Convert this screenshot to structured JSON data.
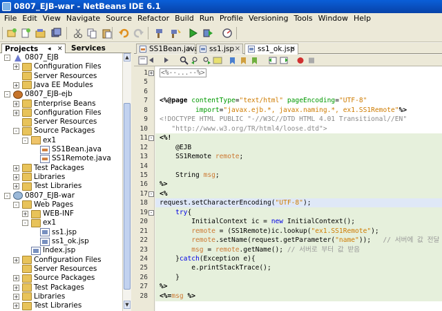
{
  "window": {
    "title": "0807_EJB-war - NetBeans IDE 6.1"
  },
  "menu": [
    "File",
    "Edit",
    "View",
    "Navigate",
    "Source",
    "Refactor",
    "Build",
    "Run",
    "Profile",
    "Versioning",
    "Tools",
    "Window",
    "Help"
  ],
  "toolbar": {
    "icons": [
      "new-project-icon",
      "new-file-icon",
      "open-project-icon",
      "save-all-icon",
      "cut-icon",
      "copy-icon",
      "paste-icon",
      "undo-icon",
      "redo-icon",
      "clean-build-icon",
      "build-icon",
      "run-icon",
      "debug-icon",
      "profile-icon"
    ]
  },
  "panel": {
    "tab_projects": "Projects",
    "tab_services": "Services",
    "tree": [
      {
        "label": "0807_EJB",
        "icon": "project-icon",
        "indent": 0,
        "toggle": "-"
      },
      {
        "label": "Configuration Files",
        "icon": "folder-icon",
        "indent": 1,
        "toggle": "+"
      },
      {
        "label": "Server Resources",
        "icon": "folder-icon",
        "indent": 1,
        "toggle": ""
      },
      {
        "label": "Java EE Modules",
        "icon": "folder-icon",
        "indent": 1,
        "toggle": "+"
      },
      {
        "label": "0807_EJB-ejb",
        "icon": "bean-icon",
        "indent": 0,
        "toggle": "-"
      },
      {
        "label": "Enterprise Beans",
        "icon": "folder-icon",
        "indent": 1,
        "toggle": "+"
      },
      {
        "label": "Configuration Files",
        "icon": "folder-icon",
        "indent": 1,
        "toggle": "+"
      },
      {
        "label": "Server Resources",
        "icon": "folder-icon",
        "indent": 1,
        "toggle": ""
      },
      {
        "label": "Source Packages",
        "icon": "folder-icon",
        "indent": 1,
        "toggle": "-"
      },
      {
        "label": "ex1",
        "icon": "package-icon",
        "indent": 2,
        "toggle": "-"
      },
      {
        "label": "SS1Bean.java",
        "icon": "java-file-icon",
        "indent": 3,
        "toggle": ""
      },
      {
        "label": "SS1Remote.java",
        "icon": "java-file-icon",
        "indent": 3,
        "toggle": ""
      },
      {
        "label": "Test Packages",
        "icon": "folder-icon",
        "indent": 1,
        "toggle": "+"
      },
      {
        "label": "Libraries",
        "icon": "folder-icon",
        "indent": 1,
        "toggle": "+"
      },
      {
        "label": "Test Libraries",
        "icon": "folder-icon",
        "indent": 1,
        "toggle": "+"
      },
      {
        "label": "0807_EJB-war",
        "icon": "web-project-icon",
        "indent": 0,
        "toggle": "-"
      },
      {
        "label": "Web Pages",
        "icon": "folder-icon",
        "indent": 1,
        "toggle": "-"
      },
      {
        "label": "WEB-INF",
        "icon": "folder-icon",
        "indent": 2,
        "toggle": "+"
      },
      {
        "label": "ex1",
        "icon": "folder-icon",
        "indent": 2,
        "toggle": "-"
      },
      {
        "label": "ss1.jsp",
        "icon": "jsp-file-icon",
        "indent": 3,
        "toggle": ""
      },
      {
        "label": "ss1_ok.jsp",
        "icon": "jsp-file-icon",
        "indent": 3,
        "toggle": ""
      },
      {
        "label": "Index.jsp",
        "icon": "jsp-file-icon",
        "indent": 2,
        "toggle": ""
      },
      {
        "label": "Configuration Files",
        "icon": "folder-icon",
        "indent": 1,
        "toggle": "+"
      },
      {
        "label": "Server Resources",
        "icon": "folder-icon",
        "indent": 1,
        "toggle": ""
      },
      {
        "label": "Source Packages",
        "icon": "folder-icon",
        "indent": 1,
        "toggle": "+"
      },
      {
        "label": "Test Packages",
        "icon": "folder-icon",
        "indent": 1,
        "toggle": "+"
      },
      {
        "label": "Libraries",
        "icon": "folder-icon",
        "indent": 1,
        "toggle": "+"
      },
      {
        "label": "Test Libraries",
        "icon": "folder-icon",
        "indent": 1,
        "toggle": "+"
      }
    ]
  },
  "editor": {
    "tabs": [
      {
        "label": "SS1Bean.java",
        "type": "java",
        "active": false
      },
      {
        "label": "ss1.jsp",
        "type": "jsp",
        "active": false
      },
      {
        "label": "ss1_ok.jsp",
        "type": "jsp",
        "active": true
      }
    ],
    "lines": [
      {
        "n": "1",
        "fold": "+",
        "hl": false,
        "parts": [
          [
            "collapsed",
            "<%--...--%>"
          ]
        ]
      },
      {
        "n": "5",
        "hl": false,
        "parts": []
      },
      {
        "n": "6",
        "hl": false,
        "parts": []
      },
      {
        "n": "7",
        "hl": false,
        "parts": [
          [
            "dir",
            "<%@page "
          ],
          [
            "attr",
            "contentType"
          ],
          [
            "plain",
            "="
          ],
          [
            "str",
            "\"text/html\""
          ],
          [
            "plain",
            " "
          ],
          [
            "attr",
            "pageEncoding"
          ],
          [
            "plain",
            "="
          ],
          [
            "str",
            "\"UTF-8\""
          ]
        ]
      },
      {
        "n": "8",
        "hl": false,
        "parts": [
          [
            "plain",
            "         "
          ],
          [
            "attr",
            "import"
          ],
          [
            "plain",
            "="
          ],
          [
            "str",
            "\"javax.ejb.*, javax.naming.*, ex1.SS1Remote\""
          ],
          [
            "dir",
            "%>"
          ]
        ]
      },
      {
        "n": "9",
        "hl": false,
        "parts": [
          [
            "dtd",
            "<!DOCTYPE HTML PUBLIC \"-//W3C//DTD HTML 4.01 Transitional//EN\""
          ]
        ]
      },
      {
        "n": "10",
        "hl": false,
        "parts": [
          [
            "dtd",
            "   \"http://www.w3.org/TR/html4/loose.dtd\">"
          ]
        ]
      },
      {
        "n": "11",
        "fold": "-",
        "hl": true,
        "parts": [
          [
            "dir",
            "<%!"
          ]
        ]
      },
      {
        "n": "12",
        "hl": true,
        "parts": [
          [
            "plain",
            "    @EJB"
          ]
        ]
      },
      {
        "n": "13",
        "hl": true,
        "parts": [
          [
            "plain",
            "    SS1Remote "
          ],
          [
            "obj",
            "remote"
          ],
          [
            "plain",
            ";"
          ]
        ]
      },
      {
        "n": "14",
        "hl": true,
        "parts": []
      },
      {
        "n": "15",
        "hl": true,
        "parts": [
          [
            "plain",
            "    String "
          ],
          [
            "obj",
            "msg"
          ],
          [
            "plain",
            ";"
          ]
        ]
      },
      {
        "n": "16",
        "hl": true,
        "parts": [
          [
            "dir",
            "%>"
          ]
        ]
      },
      {
        "n": "17",
        "fold": "-",
        "hl": true,
        "parts": [
          [
            "dir",
            "<%"
          ]
        ]
      },
      {
        "n": "18",
        "hl": true,
        "cur": true,
        "parts": [
          [
            "plain",
            "request.setCharacterEncoding("
          ],
          [
            "str",
            "\"UTF-8\""
          ],
          [
            "plain",
            ");"
          ]
        ]
      },
      {
        "n": "19",
        "fold": "-",
        "hl": true,
        "parts": [
          [
            "plain",
            "    "
          ],
          [
            "kw",
            "try"
          ],
          [
            "plain",
            "{"
          ]
        ]
      },
      {
        "n": "20",
        "hl": true,
        "parts": [
          [
            "plain",
            "        InitialContext ic = "
          ],
          [
            "kw",
            "new"
          ],
          [
            "plain",
            " InitialContext();"
          ]
        ]
      },
      {
        "n": "21",
        "hl": true,
        "parts": [
          [
            "plain",
            "        "
          ],
          [
            "obj",
            "remote"
          ],
          [
            "plain",
            " = (SS1Remote)ic.lookup("
          ],
          [
            "str",
            "\"ex1.SS1Remote\""
          ],
          [
            "plain",
            ");"
          ]
        ]
      },
      {
        "n": "22",
        "hl": true,
        "parts": [
          [
            "plain",
            "        "
          ],
          [
            "obj",
            "remote"
          ],
          [
            "plain",
            ".setName(request.getParameter("
          ],
          [
            "str",
            "\"name\""
          ],
          [
            "plain",
            "));   "
          ],
          [
            "cmt",
            "// 서버에 값 전달"
          ]
        ]
      },
      {
        "n": "23",
        "hl": true,
        "parts": [
          [
            "plain",
            "        "
          ],
          [
            "obj",
            "msg"
          ],
          [
            "plain",
            " = "
          ],
          [
            "obj",
            "remote"
          ],
          [
            "plain",
            ".getName(); "
          ],
          [
            "cmt",
            "// 서버로 부터 값 받음"
          ]
        ]
      },
      {
        "n": "24",
        "hl": true,
        "parts": [
          [
            "plain",
            "    }"
          ],
          [
            "kw",
            "catch"
          ],
          [
            "plain",
            "(Exception e){"
          ]
        ]
      },
      {
        "n": "25",
        "hl": true,
        "parts": [
          [
            "plain",
            "        e.printStackTrace();"
          ]
        ]
      },
      {
        "n": "26",
        "hl": true,
        "parts": [
          [
            "plain",
            "    }"
          ]
        ]
      },
      {
        "n": "27",
        "hl": true,
        "parts": [
          [
            "dir",
            "%>"
          ]
        ]
      },
      {
        "n": "28",
        "hl": true,
        "parts": [
          [
            "dir",
            "<%="
          ],
          [
            "obj",
            "msg"
          ],
          [
            "plain",
            " "
          ],
          [
            "dir",
            "%>"
          ]
        ]
      }
    ]
  },
  "colors": {
    "title_bar": "#0842a8",
    "chrome": "#ece9d8",
    "code_block_bg": "#e6f0dc",
    "current_line_bg": "#dfe8f7"
  }
}
